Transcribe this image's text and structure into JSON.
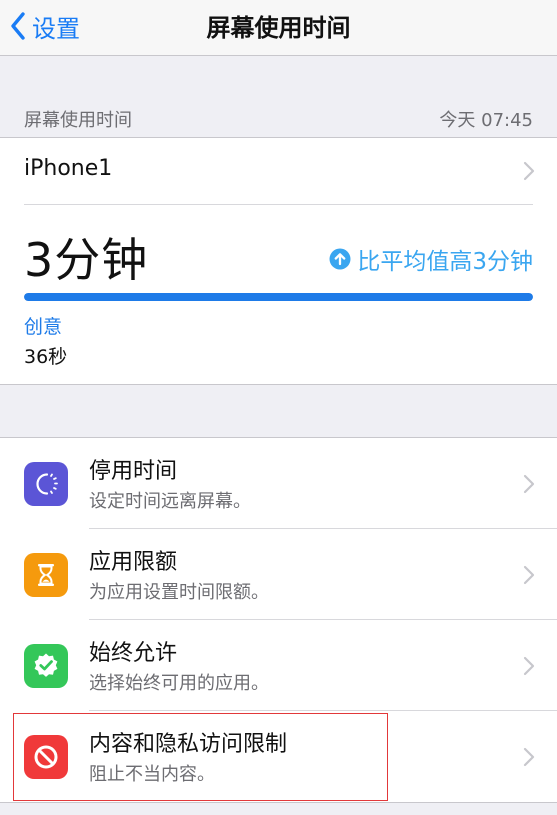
{
  "nav": {
    "back_label": "设置",
    "title": "屏幕使用时间"
  },
  "summary_header": {
    "label": "屏幕使用时间",
    "timestamp": "今天 07:45"
  },
  "summary": {
    "device": "iPhone1",
    "total": "3分钟",
    "comparison": "比平均值高3分钟",
    "bar_fill_fraction": 1.0,
    "top_category": "创意",
    "top_category_time": "36秒",
    "colors": {
      "bar": "#1e7be8",
      "comparison": "#3aa6f0"
    }
  },
  "items": [
    {
      "title": "停用时间",
      "subtitle": "设定时间远离屏幕。",
      "icon": "downtime-icon",
      "color": "#5b55d6"
    },
    {
      "title": "应用限额",
      "subtitle": "为应用设置时间限额。",
      "icon": "hourglass-icon",
      "color": "#f59a0d"
    },
    {
      "title": "始终允许",
      "subtitle": "选择始终可用的应用。",
      "icon": "checkmark-badge-icon",
      "color": "#34c759"
    },
    {
      "title": "内容和隐私访问限制",
      "subtitle": "阻止不当内容。",
      "icon": "block-icon",
      "color": "#f0393a"
    }
  ],
  "annotation": {
    "highlight_color": "#e2383a"
  }
}
